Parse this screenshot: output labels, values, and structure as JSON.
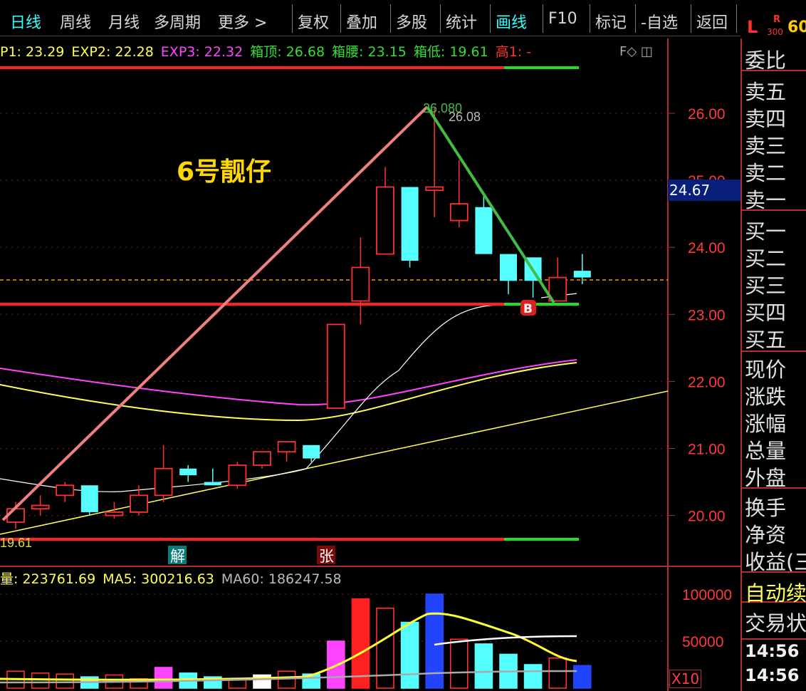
{
  "toolbar": {
    "items": [
      {
        "label": "日线",
        "active": true
      },
      {
        "label": "周线",
        "active": false
      },
      {
        "label": "月线",
        "active": false
      },
      {
        "label": "多周期",
        "active": false
      },
      {
        "label": "更多 >",
        "active": false
      },
      {
        "label": "复权",
        "active": false
      },
      {
        "label": "叠加",
        "active": false
      },
      {
        "label": "多股",
        "active": false
      },
      {
        "label": "统计",
        "active": false
      },
      {
        "label": "画线",
        "active": true
      },
      {
        "label": "F10",
        "active": false
      },
      {
        "label": "标记",
        "active": false
      },
      {
        "label": "-自选",
        "active": false
      },
      {
        "label": "返回",
        "active": false
      }
    ],
    "badge_l": "L",
    "badge_r": "R",
    "badge_300": "300",
    "badge_60": "60"
  },
  "legend": [
    {
      "text": "P1: 23.29",
      "color": "#ffff55"
    },
    {
      "text": "EXP2: 22.28",
      "color": "#ffff55"
    },
    {
      "text": "EXP3: 22.32",
      "color": "#ff44ff"
    },
    {
      "text": "箱顶: 26.68",
      "color": "#33dd33"
    },
    {
      "text": "箱腰: 23.15",
      "color": "#33dd33"
    },
    {
      "text": "箱低: 19.61",
      "color": "#33dd33"
    },
    {
      "text": "高1: -",
      "color": "#ff3030"
    }
  ],
  "window_icons": "F◇ ◫",
  "annotation_title": "6号靓仔",
  "price_tag": "24.67",
  "peak_labels": {
    "a": "26.080",
    "b": "26.08"
  },
  "low_label": "19.61",
  "markers": {
    "jie": "解",
    "zhang": "张",
    "buy": "B"
  },
  "vol_legend": [
    {
      "text": "量: 223761.69",
      "color": "#ffff55"
    },
    {
      "text": "MA5: 300216.63",
      "color": "#ffff55"
    },
    {
      "text": "MA60: 186247.58",
      "color": "#bbbbbb"
    }
  ],
  "vol_multiplier": "X10",
  "right_panel": {
    "items": [
      "委比",
      "卖五",
      "卖四",
      "卖三",
      "卖二",
      "卖一",
      "买一",
      "买二",
      "买三",
      "买四",
      "买五",
      "现价",
      "涨跌",
      "涨幅",
      "总量",
      "外盘",
      "换手",
      "净资",
      "收益(三"
    ],
    "auto": "自动续",
    "trade": "交易状",
    "time1": "14:56",
    "time2": "14:56"
  },
  "chart_data": {
    "type": "candlestick",
    "y_ticks": [
      "26.00",
      "25.00",
      "24.00",
      "23.00",
      "22.00",
      "21.00",
      "20.00"
    ],
    "ylim": [
      19.4,
      26.6
    ],
    "candles": [
      {
        "o": 19.9,
        "h": 20.2,
        "l": 19.8,
        "c": 20.1
      },
      {
        "o": 20.1,
        "h": 20.3,
        "l": 20.0,
        "c": 20.15
      },
      {
        "o": 20.3,
        "h": 20.5,
        "l": 20.2,
        "c": 20.45
      },
      {
        "o": 20.45,
        "h": 20.45,
        "l": 20.0,
        "c": 20.05
      },
      {
        "o": 20.0,
        "h": 20.2,
        "l": 19.95,
        "c": 20.05
      },
      {
        "o": 20.05,
        "h": 20.45,
        "l": 20.0,
        "c": 20.3
      },
      {
        "o": 20.3,
        "h": 21.05,
        "l": 20.2,
        "c": 20.7
      },
      {
        "o": 20.7,
        "h": 20.75,
        "l": 20.5,
        "c": 20.6
      },
      {
        "o": 20.5,
        "h": 20.7,
        "l": 20.45,
        "c": 20.45
      },
      {
        "o": 20.45,
        "h": 20.8,
        "l": 20.4,
        "c": 20.75
      },
      {
        "o": 20.75,
        "h": 20.95,
        "l": 20.7,
        "c": 20.95
      },
      {
        "o": 20.95,
        "h": 21.1,
        "l": 20.8,
        "c": 21.1
      },
      {
        "o": 21.05,
        "h": 21.05,
        "l": 20.8,
        "c": 20.85
      },
      {
        "o": 21.6,
        "h": 22.85,
        "l": 21.6,
        "c": 22.85
      },
      {
        "o": 23.2,
        "h": 24.15,
        "l": 22.85,
        "c": 23.7
      },
      {
        "o": 23.9,
        "h": 25.2,
        "l": 23.9,
        "c": 24.9
      },
      {
        "o": 24.9,
        "h": 24.9,
        "l": 23.7,
        "c": 23.8
      },
      {
        "o": 24.85,
        "h": 26.08,
        "l": 24.45,
        "c": 24.9
      },
      {
        "o": 24.4,
        "h": 25.3,
        "l": 24.3,
        "c": 24.65
      },
      {
        "o": 24.6,
        "h": 24.8,
        "l": 23.9,
        "c": 23.9
      },
      {
        "o": 23.9,
        "h": 23.9,
        "l": 23.3,
        "c": 23.5
      },
      {
        "o": 23.85,
        "h": 23.85,
        "l": 23.25,
        "c": 23.5
      },
      {
        "o": 23.2,
        "h": 23.85,
        "l": 23.2,
        "c": 23.55
      },
      {
        "o": 23.65,
        "h": 23.9,
        "l": 23.45,
        "c": 23.55
      }
    ],
    "box_levels": {
      "top": 26.68,
      "mid": 23.15,
      "low": 19.61
    },
    "volume": {
      "y_ticks": [
        "100000",
        "50000"
      ],
      "values": [
        18000,
        16000,
        15000,
        12000,
        14000,
        10000,
        22000,
        16000,
        12000,
        10000,
        14000,
        18000,
        15000,
        50000,
        95000,
        85000,
        70000,
        100000,
        52000,
        47000,
        36000,
        25000,
        32000,
        24000
      ]
    }
  }
}
